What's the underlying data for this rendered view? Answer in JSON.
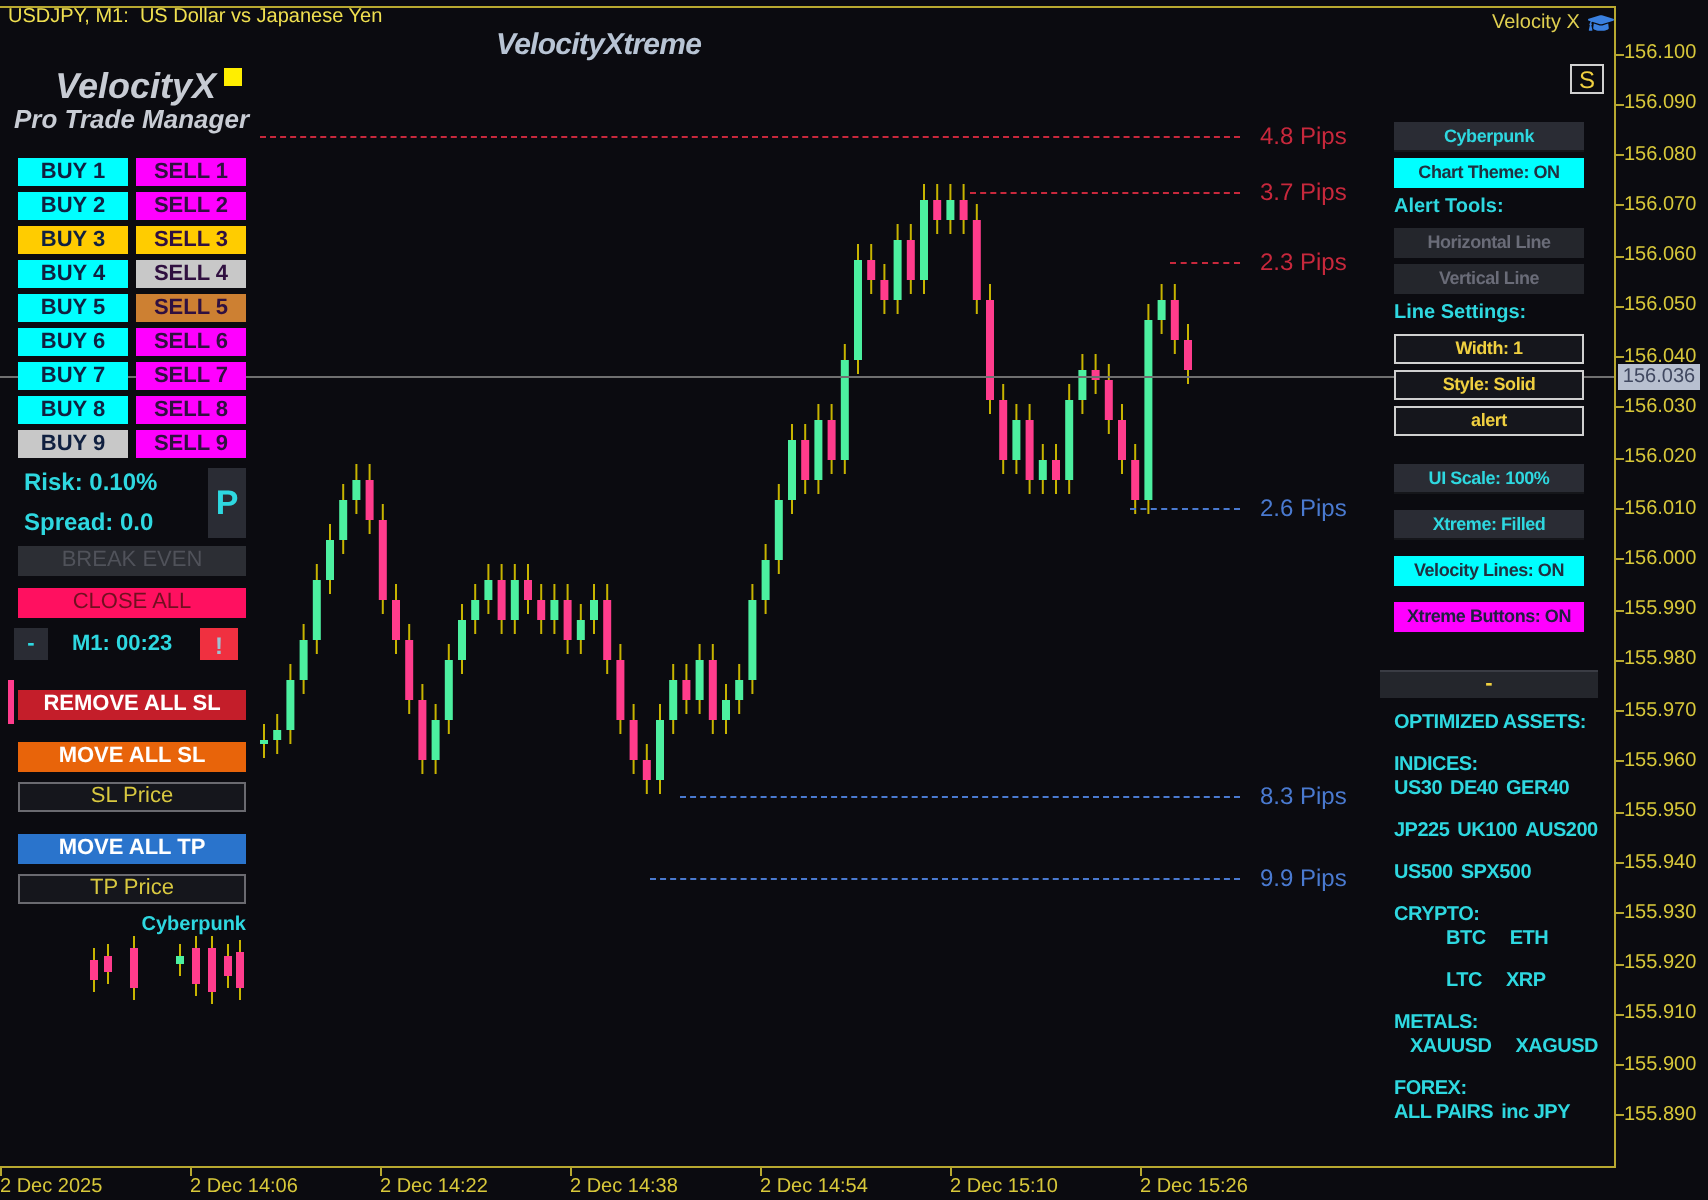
{
  "header": {
    "title": "USDJPY, M1:  US Dollar vs Japanese Yen",
    "brand": "Velocity X"
  },
  "chart_logo": "VelocityXtreme",
  "logo": {
    "name": "VelocityX",
    "subtitle": "Pro Trade Manager"
  },
  "trade_buttons": [
    {
      "buy": {
        "label": "BUY 1",
        "color": "#00ffff"
      },
      "sell": {
        "label": "SELL 1",
        "color": "#ff00ff"
      }
    },
    {
      "buy": {
        "label": "BUY 2",
        "color": "#00ffff"
      },
      "sell": {
        "label": "SELL 2",
        "color": "#ff00ff"
      }
    },
    {
      "buy": {
        "label": "BUY 3",
        "color": "#ffcc00"
      },
      "sell": {
        "label": "SELL 3",
        "color": "#ffcc00"
      }
    },
    {
      "buy": {
        "label": "BUY 4",
        "color": "#00ffff"
      },
      "sell": {
        "label": "SELL 4",
        "color": "#c8c8c8"
      }
    },
    {
      "buy": {
        "label": "BUY 5",
        "color": "#00ffff"
      },
      "sell": {
        "label": "SELL 5",
        "color": "#cd8032"
      }
    },
    {
      "buy": {
        "label": "BUY 6",
        "color": "#00ffff"
      },
      "sell": {
        "label": "SELL 6",
        "color": "#ff00ff"
      }
    },
    {
      "buy": {
        "label": "BUY 7",
        "color": "#00ffff"
      },
      "sell": {
        "label": "SELL 7",
        "color": "#ff00ff"
      }
    },
    {
      "buy": {
        "label": "BUY 8",
        "color": "#00ffff"
      },
      "sell": {
        "label": "SELL 8",
        "color": "#ff00ff"
      }
    },
    {
      "buy": {
        "label": "BUY 9",
        "color": "#c8c8c8"
      },
      "sell": {
        "label": "SELL 9",
        "color": "#ff00ff"
      }
    }
  ],
  "risk": "Risk: 0.10%",
  "spread": "Spread: 0.0",
  "p_button": "P",
  "break_even": "BREAK EVEN",
  "close_all": "CLOSE ALL",
  "minimize": "-",
  "timer": "M1: 00:23",
  "alert_button": "!",
  "sl_tp": [
    {
      "kind": "action",
      "label": "REMOVE ALL SL",
      "color": "#c41e2a"
    },
    {
      "kind": "action",
      "label": "MOVE ALL SL",
      "color": "#e8640a"
    },
    {
      "kind": "field",
      "placeholder": "SL Price"
    },
    {
      "kind": "action",
      "label": "MOVE ALL TP",
      "color": "#2a74cc"
    },
    {
      "kind": "field",
      "placeholder": "TP Price"
    }
  ],
  "theme_label": "Cyberpunk",
  "right_panel": {
    "s_button": "S",
    "items": [
      {
        "kind": "dark",
        "label": "Cyberpunk"
      },
      {
        "kind": "cyan",
        "label": "Chart Theme: ON"
      },
      {
        "kind": "heading",
        "label": "Alert Tools:"
      },
      {
        "kind": "disabled",
        "label": "Horizontal Line"
      },
      {
        "kind": "disabled",
        "label": "Vertical Line"
      },
      {
        "kind": "heading",
        "label": "Line Settings:"
      },
      {
        "kind": "outlined",
        "label": "Width: 1"
      },
      {
        "kind": "outlined",
        "label": "Style: Solid"
      },
      {
        "kind": "outlined",
        "label": "alert"
      },
      {
        "kind": "dark",
        "label": "UI Scale: 100%"
      },
      {
        "kind": "dark",
        "label": "Xtreme: Filled"
      },
      {
        "kind": "cyan",
        "label": "Velocity Lines: ON"
      },
      {
        "kind": "magenta",
        "label": "Xtreme Buttons: ON"
      }
    ],
    "collapse": "-"
  },
  "assets": [
    {
      "kind": "heading",
      "items": [
        "OPTIMIZED ASSETS:"
      ]
    },
    {
      "kind": "heading",
      "items": [
        "INDICES:"
      ]
    },
    {
      "kind": "row",
      "items": [
        "US30",
        "DE40",
        "GER40"
      ]
    },
    {
      "kind": "row",
      "items": [
        "JP225",
        "UK100",
        "AUS200"
      ]
    },
    {
      "kind": "row",
      "items": [
        "US500",
        "SPX500"
      ]
    },
    {
      "kind": "heading",
      "items": [
        "CRYPTO:"
      ]
    },
    {
      "kind": "sub",
      "items": [
        "BTC",
        "ETH"
      ]
    },
    {
      "kind": "sub",
      "items": [
        "LTC",
        "XRP"
      ]
    },
    {
      "kind": "heading",
      "items": [
        "METALS:"
      ]
    },
    {
      "kind": "indent",
      "items": [
        "XAUUSD",
        "XAGUSD"
      ]
    },
    {
      "kind": "heading",
      "items": [
        "FOREX:"
      ]
    },
    {
      "kind": "row",
      "items": [
        "ALL PAIRS",
        "inc JPY"
      ]
    }
  ],
  "pips_lines": [
    {
      "label": "4.8 Pips",
      "color": "#c8283c"
    },
    {
      "label": "3.7 Pips",
      "color": "#c8283c"
    },
    {
      "label": "2.3 Pips",
      "color": "#c8283c"
    },
    {
      "label": "2.6 Pips",
      "color": "#4a7ad0"
    },
    {
      "label": "8.3 Pips",
      "color": "#4a7ad0"
    },
    {
      "label": "9.9 Pips",
      "color": "#4a7ad0"
    }
  ],
  "price_axis": [
    "156.100",
    "156.090",
    "156.080",
    "156.070",
    "156.060",
    "156.050",
    "156.040",
    "156.030",
    "156.020",
    "156.010",
    "156.000",
    "155.990",
    "155.980",
    "155.970",
    "155.960",
    "155.950",
    "155.940",
    "155.930",
    "155.920",
    "155.910",
    "155.900",
    "155.890"
  ],
  "current_price": "156.036",
  "time_axis": [
    "2 Dec 2025",
    "2 Dec 14:06",
    "2 Dec 14:22",
    "2 Dec 14:38",
    "2 Dec 14:54",
    "2 Dec 15:10",
    "2 Dec 15:26"
  ]
}
